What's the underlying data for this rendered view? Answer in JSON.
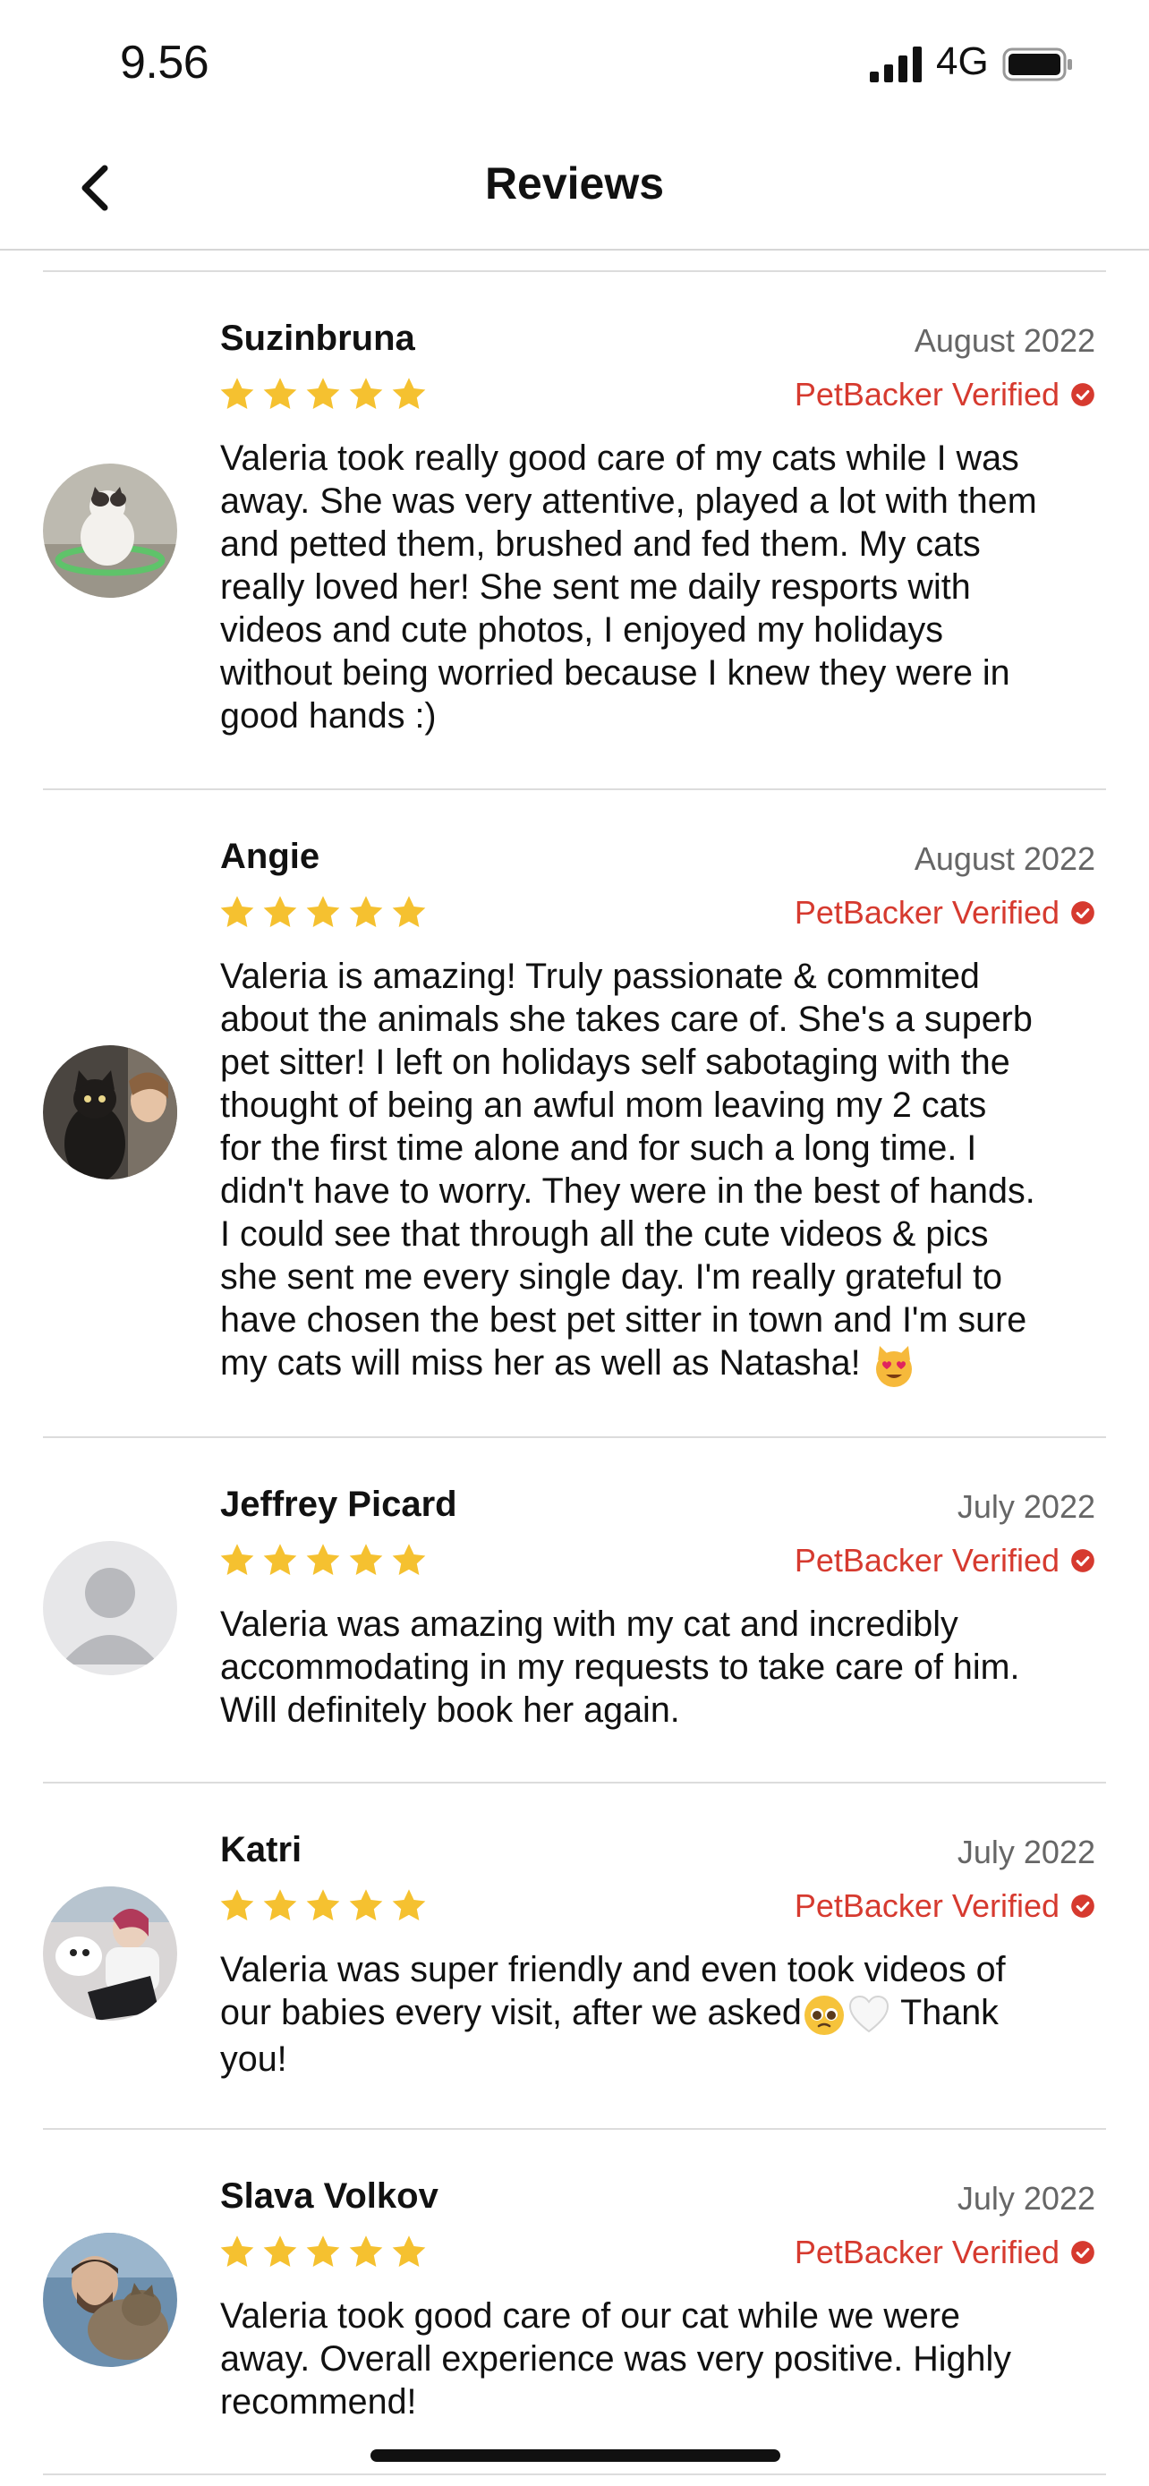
{
  "status_bar": {
    "time": "9.56",
    "network": "4G"
  },
  "header": {
    "title": "Reviews"
  },
  "verified_label": "PetBacker Verified",
  "reviews": [
    {
      "name": "Suzinbruna",
      "date": "August 2022",
      "rating": 5,
      "text": "Valeria took really good care of my cats while I was\naway. She was very attentive, played a lot with them\nand petted them, brushed and fed them. My cats\nreally loved her! She sent me daily resports with\nvideos and cute photos, I enjoyed my holidays\nwithout being worried because I knew they were in\ngood hands :)"
    },
    {
      "name": "Angie",
      "date": "August 2022",
      "rating": 5,
      "text": "Valeria is amazing! Truly passionate & commited\nabout the animals she takes care of. She's a superb\npet sitter! I left on holidays self sabotaging with the\nthought of being an awful mom leaving my 2 cats\nfor the first time alone and for such a long time. I\ndidn't have to worry. They were in the best of hands.\nI could see that through all the cute videos & pics\nshe sent me every single day. I'm really grateful to\nhave chosen the best pet sitter in town and I'm sure\nmy cats will miss her as well as Natasha! ",
      "emoji_end": "heart-eyes-cat-emoji"
    },
    {
      "name": "Jeffrey Picard",
      "date": "July 2022",
      "rating": 5,
      "text": "Valeria was amazing with my cat and incredibly\naccommodating in my requests to take care of him.\nWill definitely book her again."
    },
    {
      "name": "Katri",
      "date": "July 2022",
      "rating": 5,
      "text_before": "Valeria was super friendly and even took videos of\nour babies every visit, after we asked",
      "text_after": " Thank\nyou!",
      "emojis": [
        "pleading-face-emoji",
        "white-heart-emoji"
      ]
    },
    {
      "name": "Slava Volkov",
      "date": "July 2022",
      "rating": 5,
      "text": "Valeria took good care of our cat while we were\naway. Overall experience was very positive. Highly\nrecommend!"
    }
  ],
  "colors": {
    "star": "#f5c130",
    "verified": "#d63a2f",
    "divider": "#dcdcdc"
  }
}
